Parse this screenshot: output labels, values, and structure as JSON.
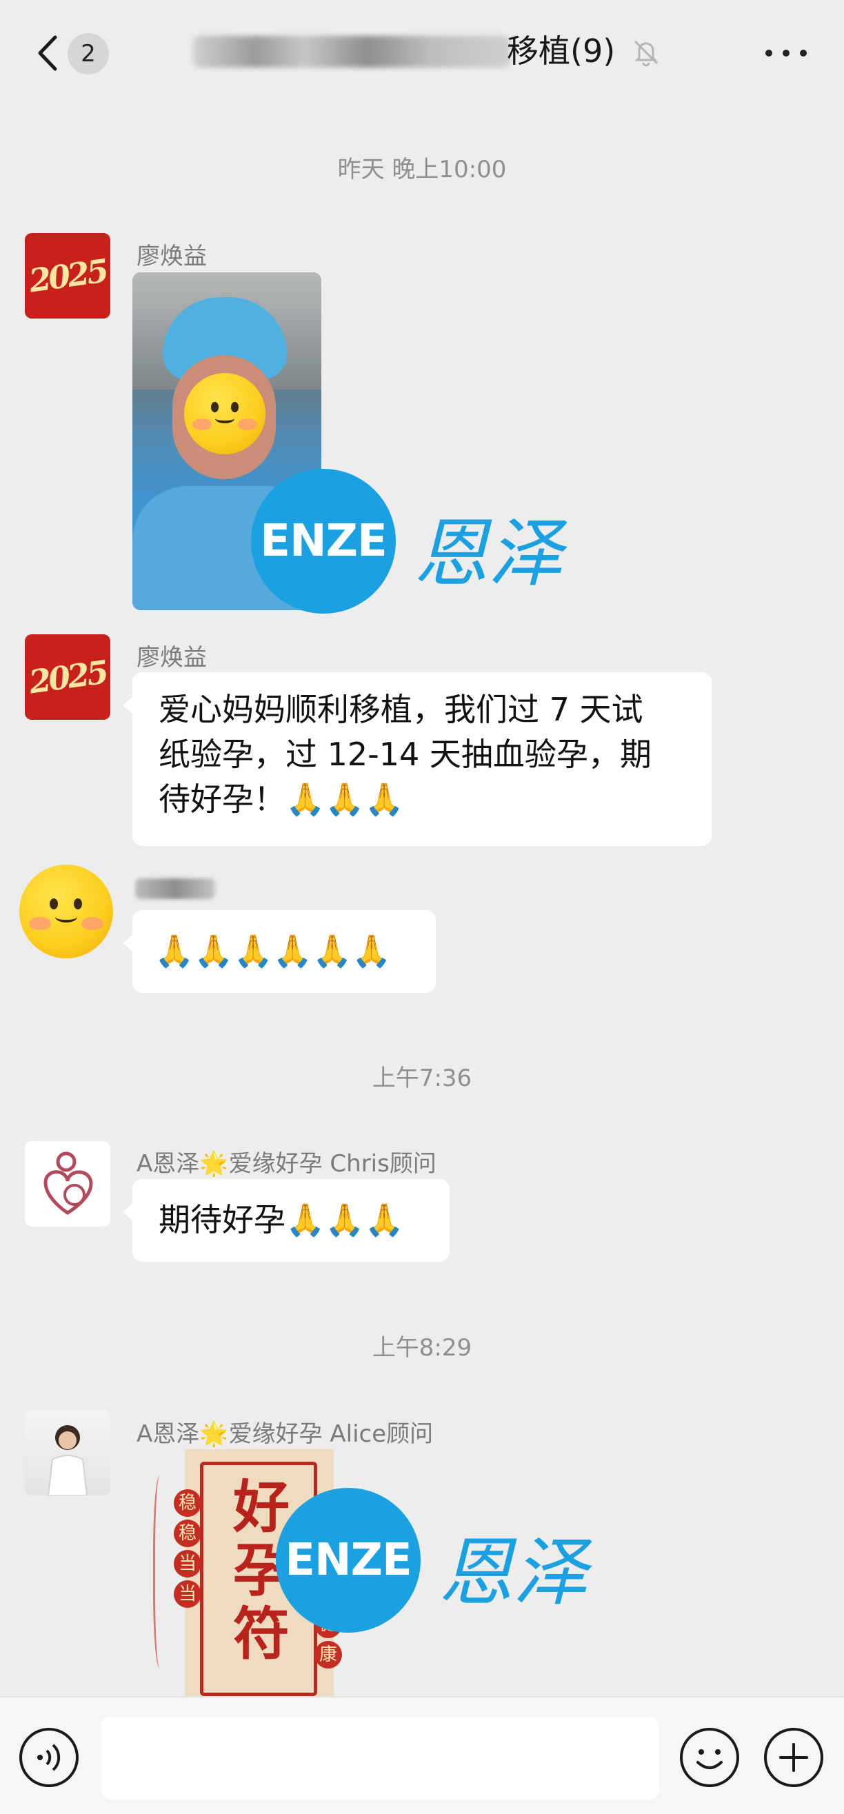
{
  "header": {
    "unread_count": "2",
    "title": "移植(9)",
    "back_icon": "chevron-left-icon",
    "mute_icon": "bell-off-icon",
    "more_icon": "more-dots-icon"
  },
  "messages": [
    {
      "type": "timestamp",
      "text": "昨天 晚上10:00"
    },
    {
      "type": "image",
      "sender": "廖焕益",
      "avatar_text": "2025",
      "image_desc": "photo"
    },
    {
      "type": "text",
      "sender": "廖焕益",
      "avatar_text": "2025",
      "lines": [
        "爱心妈妈顺利移植，我们过 7 天试",
        "纸验孕，过 12-14 天抽血验孕，期",
        "待好孕！🙏🙏🙏"
      ]
    },
    {
      "type": "text",
      "sender": "",
      "lines": [
        "🙏🙏🙏🙏🙏🙏"
      ]
    },
    {
      "type": "timestamp",
      "text": "上午7:36"
    },
    {
      "type": "text",
      "sender": "A恩泽🌟爱缘好孕 Chris顾问",
      "lines": [
        "期待好孕🙏🙏🙏"
      ]
    },
    {
      "type": "timestamp",
      "text": "上午8:29"
    },
    {
      "type": "sticker",
      "sender": "A恩泽🌟爱缘好孕 Alice顾问",
      "sticker_main": [
        "好",
        "孕",
        "符"
      ],
      "sticker_left": [
        "稳",
        "稳",
        "当",
        "当"
      ],
      "sticker_right": [
        "健",
        "康"
      ]
    }
  ],
  "watermark": {
    "circle": "ENZE",
    "cn": "恩泽"
  },
  "input_bar": {
    "voice_icon": "voice-icon",
    "emoji_icon": "smiley-icon",
    "plus_icon": "plus-icon",
    "placeholder": ""
  },
  "colors": {
    "background": "#ededed",
    "bubble": "#ffffff",
    "watermark": "#1ba0e2",
    "sticker_red": "#b8241b"
  }
}
